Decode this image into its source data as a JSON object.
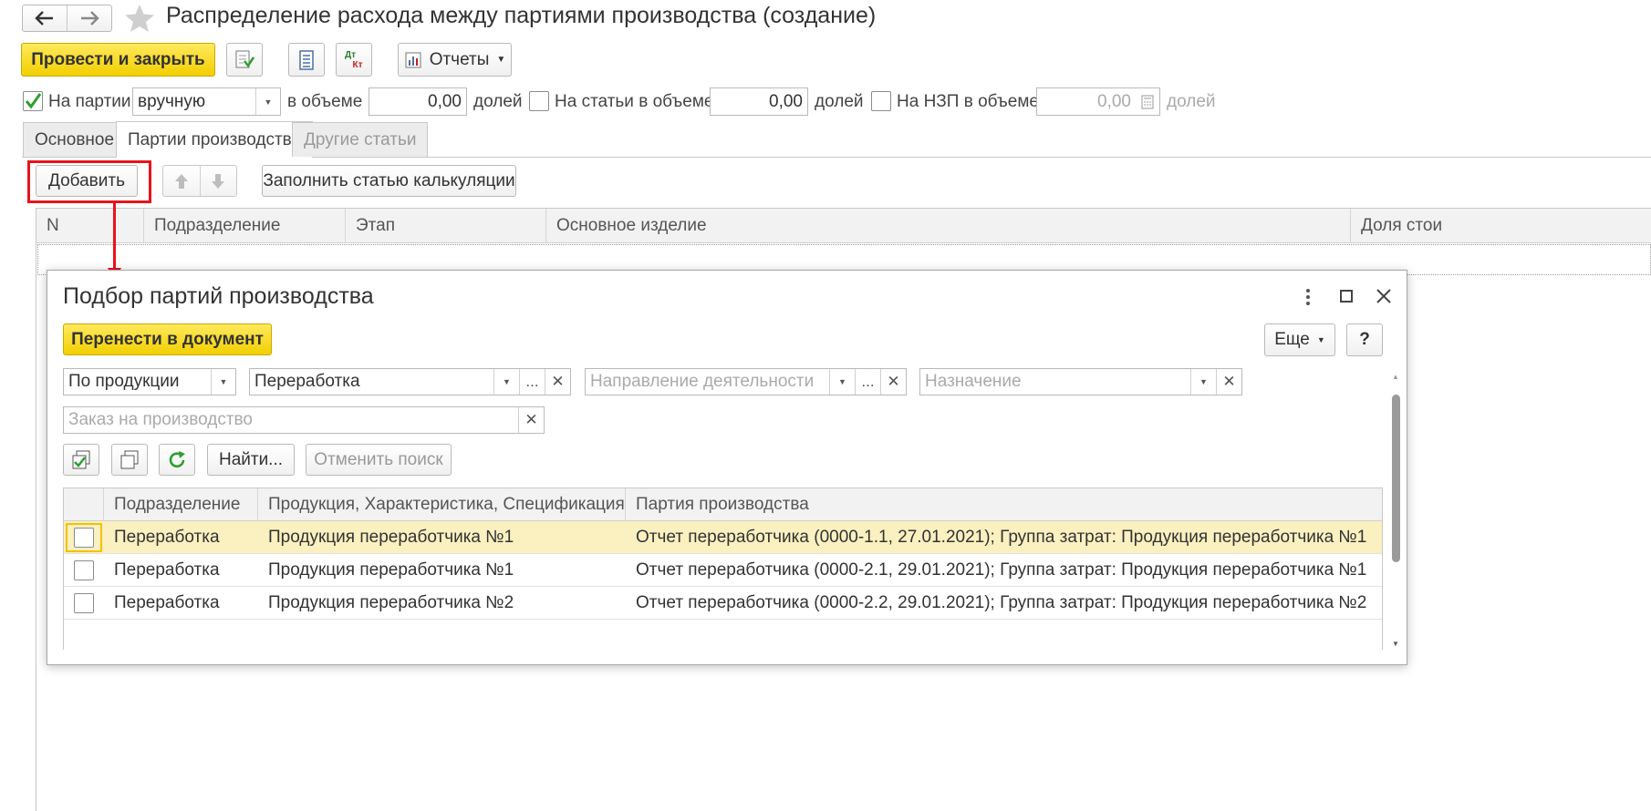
{
  "window": {
    "title": "Распределение расхода между партиями производства (создание)"
  },
  "toolbar": {
    "post_close": "Провести и закрыть",
    "reports": "Отчеты",
    "dtkt_top": "Дт",
    "dtkt_bottom": "Кт"
  },
  "params": {
    "on_batches_label": "На партии",
    "on_batches_checked": true,
    "mode_value": "вручную",
    "volume_label_1": "в объеме",
    "volume_value_1": "0,00",
    "shares_label_1": "долей",
    "on_items_label": "На статьи в объеме",
    "volume_value_2": "0,00",
    "shares_label_2": "долей",
    "on_wip_label": "На НЗП в объеме",
    "volume_value_3": "0,00",
    "shares_label_3": "долей"
  },
  "tabs": [
    {
      "label": "Основное"
    },
    {
      "label": "Партии производства"
    },
    {
      "label": "Другие статьи"
    }
  ],
  "batches_toolbar": {
    "add": "Добавить",
    "fill_item": "Заполнить статью калькуляции"
  },
  "main_table": {
    "columns": [
      "N",
      "Подразделение",
      "Этап",
      "Основное изделие",
      "Доля стои"
    ]
  },
  "dialog": {
    "title": "Подбор партий производства",
    "transfer": "Перенести в документ",
    "more": "Еще",
    "help": "?",
    "filter_mode": "По продукции",
    "filter_division": "Переработка",
    "filter_direction_placeholder": "Направление деятельности",
    "filter_purpose_placeholder": "Назначение",
    "filter_order_placeholder": "Заказ на производство",
    "find": "Найти...",
    "cancel_search": "Отменить поиск",
    "ellipsis": "...",
    "columns": [
      "Подразделение",
      "Продукция, Характеристика, Спецификация, ...",
      "Партия производства"
    ],
    "rows": [
      {
        "division": "Переработка",
        "product": "Продукция переработчика №1",
        "batch": "Отчет переработчика (0000-1.1, 27.01.2021); Группа затрат: Продукция переработчика №1"
      },
      {
        "division": "Переработка",
        "product": "Продукция переработчика №1",
        "batch": "Отчет переработчика (0000-2.1, 29.01.2021); Группа затрат: Продукция переработчика №1"
      },
      {
        "division": "Переработка",
        "product": "Продукция переработчика №2",
        "batch": "Отчет переработчика (0000-2.2, 29.01.2021); Группа затрат: Продукция переработчика №2"
      }
    ]
  },
  "colors": {
    "accent_yellow": "#f5d400",
    "highlight_red": "#e8141b",
    "selected_row": "#fbf0c0"
  }
}
